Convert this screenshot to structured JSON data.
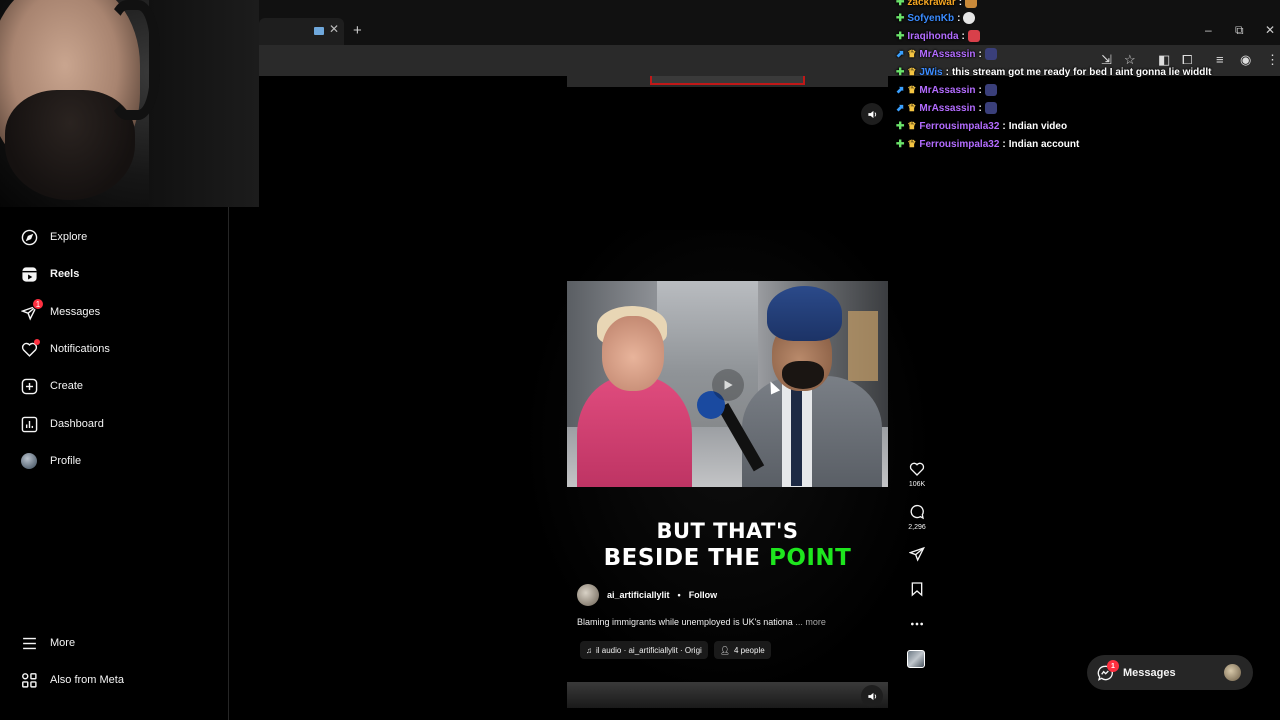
{
  "nav": {
    "items": [
      {
        "label": "Explore",
        "icon": "compass-icon"
      },
      {
        "label": "Reels",
        "icon": "reels-icon"
      },
      {
        "label": "Messages",
        "icon": "messenger-icon",
        "badge": "1"
      },
      {
        "label": "Notifications",
        "icon": "heart-icon"
      },
      {
        "label": "Create",
        "icon": "plus-square-icon"
      },
      {
        "label": "Dashboard",
        "icon": "dashboard-icon"
      },
      {
        "label": "Profile",
        "icon": "avatar"
      }
    ],
    "bottom": [
      {
        "label": "More",
        "icon": "menu-icon"
      },
      {
        "label": "Also from Meta",
        "icon": "meta-grid-icon"
      }
    ]
  },
  "reel": {
    "caption_line1": "BUT THAT'S",
    "caption_line2_white": "BESIDE THE ",
    "caption_line2_green": "POINT",
    "author": "ai_artificiallylit",
    "separator": "•",
    "follow": "Follow",
    "description": "Blaming immigrants while unemployed is UK's nationa",
    "more": "... more",
    "audio": "il audio · ai_artificiallylit · Origi",
    "people": "4 people",
    "likes": "106K",
    "comments": "2,296"
  },
  "chat": [
    {
      "user": "zackrawar",
      "color": "#f5a623",
      "msg": ""
    },
    {
      "user": "SofyenKb",
      "color": "#3b8cff",
      "msg": ""
    },
    {
      "user": "Iraqihonda",
      "color": "#b36cff",
      "msg": ""
    },
    {
      "user": "MrAssassin",
      "color": "#b36cff",
      "msg": ""
    },
    {
      "user": "JWis",
      "color": "#3b8cff",
      "msg": "this stream got me ready for bed I aint gonna lie widdlt"
    },
    {
      "user": "MrAssassin",
      "color": "#b36cff",
      "msg": ""
    },
    {
      "user": "MrAssassin",
      "color": "#b36cff",
      "msg": ""
    },
    {
      "user": "Ferrousimpala32",
      "color": "#b36cff",
      "msg": "Indian video"
    },
    {
      "user": "Ferrousimpala32",
      "color": "#b36cff",
      "msg": "Indian account"
    }
  ],
  "messages_pill": {
    "label": "Messages",
    "badge": "1"
  },
  "colors": {
    "accent_green": "#1ee61e",
    "badge_red": "#ff3040"
  }
}
